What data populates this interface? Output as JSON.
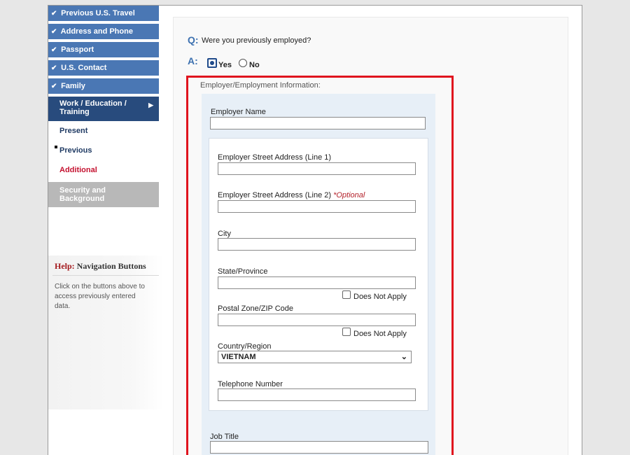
{
  "sidebar": {
    "completed_items": [
      {
        "label": "Previous U.S. Travel"
      },
      {
        "label": "Address and Phone"
      },
      {
        "label": "Passport"
      },
      {
        "label": "U.S. Contact"
      },
      {
        "label": "Family"
      }
    ],
    "check_glyph": "✔",
    "current_section": {
      "label": "Work / Education / Training",
      "arrow": "▶"
    },
    "sub_items": {
      "present": "Present",
      "previous": "Previous",
      "additional": "Additional"
    },
    "disabled_item": "Security and Background"
  },
  "help": {
    "prefix": "Help:",
    "title": " Navigation Buttons",
    "text": "Click on the buttons above to access previously entered data."
  },
  "question": {
    "q_label": "Q:",
    "text": "Were you previously employed?",
    "a_label": "A:",
    "yes": "Yes",
    "no": "No",
    "selected": "Yes"
  },
  "form": {
    "section_title": "Employer/Employment Information:",
    "employer_name": {
      "label": "Employer Name",
      "value": ""
    },
    "street1": {
      "label": "Employer Street Address (Line 1)",
      "value": ""
    },
    "street2": {
      "label": "Employer Street Address (Line 2)",
      "optional": "*Optional",
      "value": ""
    },
    "city": {
      "label": "City",
      "value": ""
    },
    "state": {
      "label": "State/Province",
      "value": "",
      "dna": "Does Not Apply"
    },
    "postal": {
      "label": "Postal Zone/ZIP Code",
      "value": "",
      "dna": "Does Not Apply"
    },
    "country": {
      "label": "Country/Region",
      "value": "VIETNAM",
      "chevron": "⌄"
    },
    "phone": {
      "label": "Telephone Number",
      "value": ""
    },
    "job_title": {
      "label": "Job Title",
      "value": ""
    }
  },
  "colors": {
    "nav_done": "#4a77b4",
    "nav_current": "#284b7d",
    "highlight_border": "#e0141e",
    "question_accent": "#3d71b0"
  }
}
